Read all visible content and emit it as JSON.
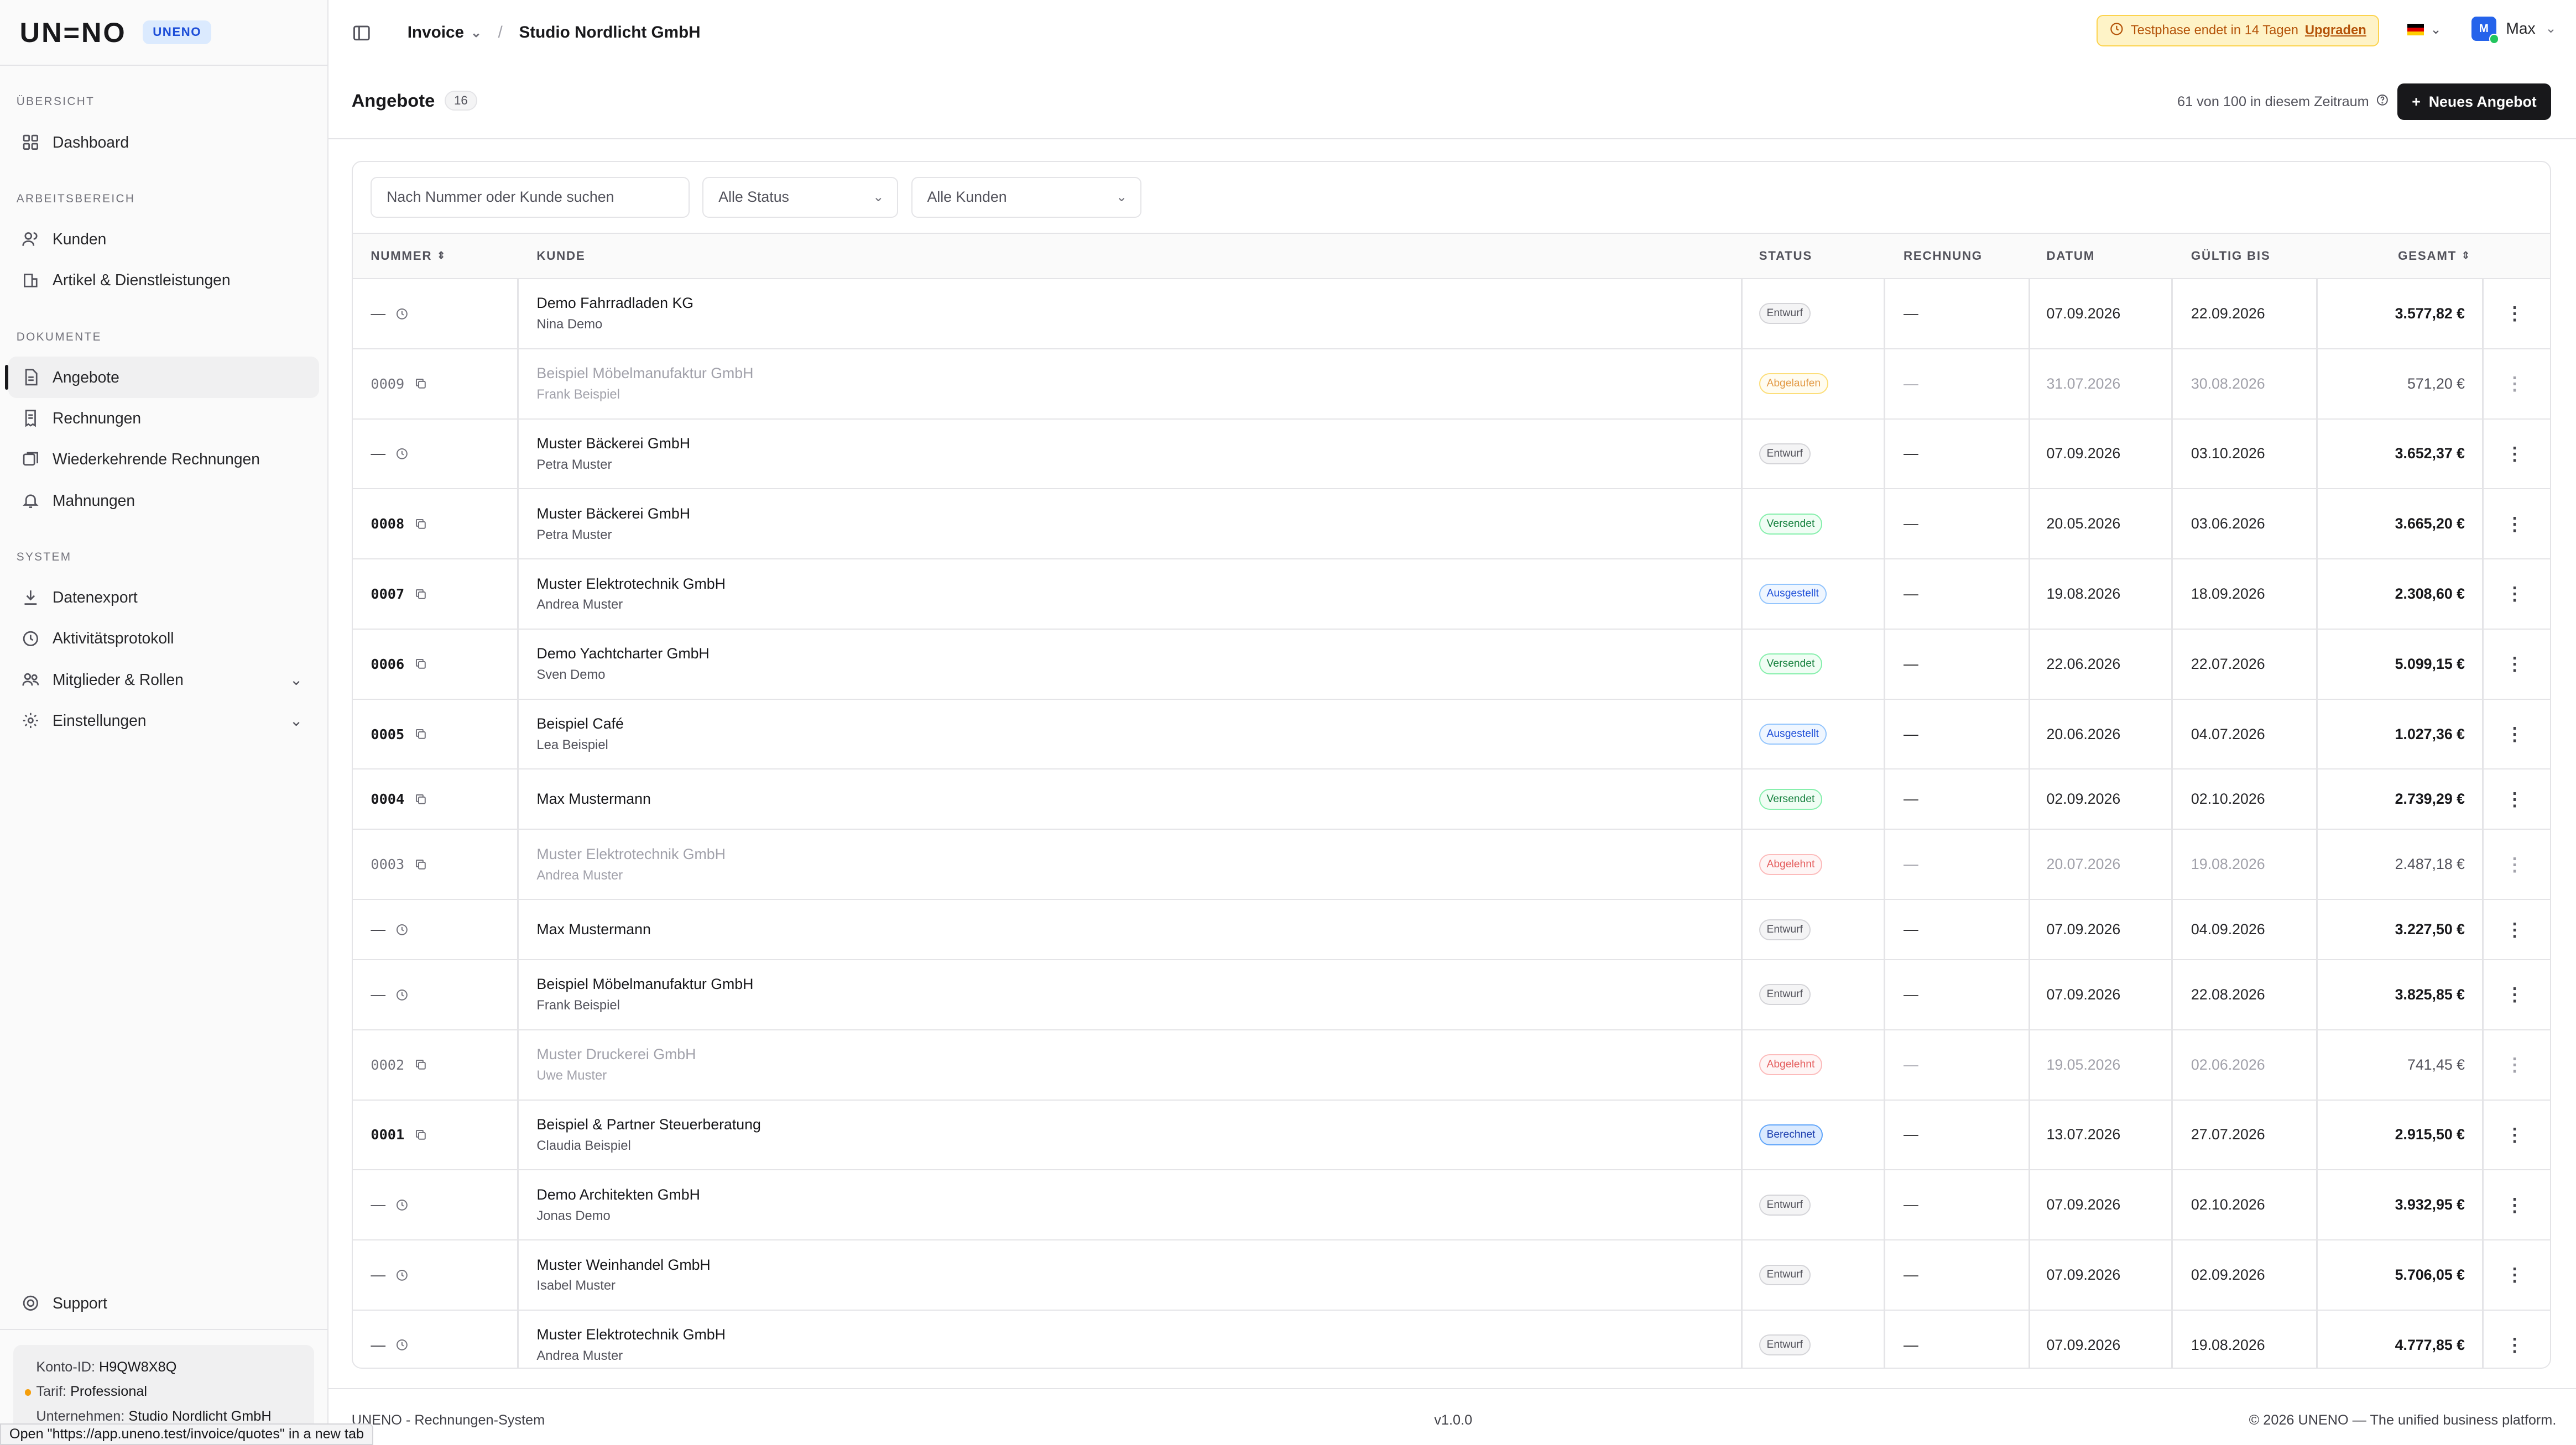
{
  "app": {
    "logo": "UN=NO",
    "badge": "UNENO"
  },
  "sidebar": {
    "sections": [
      {
        "title": "ÜBERSICHT",
        "items": [
          {
            "label": "Dashboard",
            "icon": "dashboard-icon"
          }
        ]
      },
      {
        "title": "ARBEITSBEREICH",
        "items": [
          {
            "label": "Kunden",
            "icon": "users-icon"
          },
          {
            "label": "Artikel & Dienstleistungen",
            "icon": "package-icon"
          }
        ]
      },
      {
        "title": "DOKUMENTE",
        "items": [
          {
            "label": "Angebote",
            "icon": "file-icon",
            "active": true
          },
          {
            "label": "Rechnungen",
            "icon": "receipt-icon"
          },
          {
            "label": "Wiederkehrende Rechnungen",
            "icon": "repeat-icon"
          },
          {
            "label": "Mahnungen",
            "icon": "bell-icon"
          }
        ]
      },
      {
        "title": "SYSTEM",
        "items": [
          {
            "label": "Datenexport",
            "icon": "download-icon"
          },
          {
            "label": "Aktivitätsprotokoll",
            "icon": "history-icon"
          },
          {
            "label": "Mitglieder & Rollen",
            "icon": "members-icon",
            "chevron": true
          },
          {
            "label": "Einstellungen",
            "icon": "gear-icon",
            "chevron": true
          }
        ]
      }
    ],
    "support": "Support",
    "account": {
      "konto_label": "Konto-ID:",
      "konto_value": "H9QW8X8Q",
      "tarif_label": "Tarif:",
      "tarif_value": "Professional",
      "firma_label": "Unternehmen:",
      "firma_value": "Studio Nordlicht GmbH"
    },
    "status_url": "Open \"https://app.uneno.test/invoice/quotes\" in a new tab"
  },
  "topbar": {
    "module": "Invoice",
    "separator": "/",
    "company": "Studio Nordlicht GmbH",
    "trial_text": "Testphase endet in 14 Tagen",
    "trial_link": "Upgraden",
    "user_initial": "M",
    "user_name": "Max"
  },
  "page": {
    "title": "Angebote",
    "count": "16",
    "quota": "61 von 100 in diesem Zeitraum",
    "new_button": "Neues Angebot"
  },
  "filters": {
    "search_placeholder": "Nach Nummer oder Kunde suchen",
    "status": "Alle Status",
    "customers": "Alle Kunden"
  },
  "table": {
    "headers": {
      "nummer": "NUMMER",
      "kunde": "KUNDE",
      "status": "STATUS",
      "rechnung": "RECHNUNG",
      "datum": "DATUM",
      "gueltig": "GÜLTIG BIS",
      "gesamt": "GESAMT"
    },
    "rows": [
      {
        "number": "—",
        "draft": true,
        "customer": "Demo Fahrradladen KG",
        "contact": "Nina Demo",
        "status": "Entwurf",
        "invoice": "—",
        "date": "07.09.2026",
        "valid": "22.09.2026",
        "total": "3.577,82 €"
      },
      {
        "number": "0009",
        "muted": true,
        "customer": "Beispiel Möbelmanufaktur GmbH",
        "contact": "Frank Beispiel",
        "status": "Abgelaufen",
        "invoice": "—",
        "date": "31.07.2026",
        "valid": "30.08.2026",
        "total": "571,20 €"
      },
      {
        "number": "—",
        "draft": true,
        "customer": "Muster Bäckerei GmbH",
        "contact": "Petra Muster",
        "status": "Entwurf",
        "invoice": "—",
        "date": "07.09.2026",
        "valid": "03.10.2026",
        "total": "3.652,37 €"
      },
      {
        "number": "0008",
        "customer": "Muster Bäckerei GmbH",
        "contact": "Petra Muster",
        "status": "Versendet",
        "invoice": "—",
        "date": "20.05.2026",
        "valid": "03.06.2026",
        "total": "3.665,20 €"
      },
      {
        "number": "0007",
        "customer": "Muster Elektrotechnik GmbH",
        "contact": "Andrea Muster",
        "status": "Ausgestellt",
        "invoice": "—",
        "date": "19.08.2026",
        "valid": "18.09.2026",
        "total": "2.308,60 €"
      },
      {
        "number": "0006",
        "customer": "Demo Yachtcharter GmbH",
        "contact": "Sven Demo",
        "status": "Versendet",
        "invoice": "—",
        "date": "22.06.2026",
        "valid": "22.07.2026",
        "total": "5.099,15 €"
      },
      {
        "number": "0005",
        "customer": "Beispiel Café",
        "contact": "Lea Beispiel",
        "status": "Ausgestellt",
        "invoice": "—",
        "date": "20.06.2026",
        "valid": "04.07.2026",
        "total": "1.027,36 €"
      },
      {
        "number": "0004",
        "customer": "Max Mustermann",
        "contact": "",
        "status": "Versendet",
        "invoice": "—",
        "date": "02.09.2026",
        "valid": "02.10.2026",
        "total": "2.739,29 €"
      },
      {
        "number": "0003",
        "muted": true,
        "customer": "Muster Elektrotechnik GmbH",
        "contact": "Andrea Muster",
        "status": "Abgelehnt",
        "invoice": "—",
        "date": "20.07.2026",
        "valid": "19.08.2026",
        "total": "2.487,18 €"
      },
      {
        "number": "—",
        "draft": true,
        "customer": "Max Mustermann",
        "contact": "",
        "status": "Entwurf",
        "invoice": "—",
        "date": "07.09.2026",
        "valid": "04.09.2026",
        "total": "3.227,50 €"
      },
      {
        "number": "—",
        "draft": true,
        "customer": "Beispiel Möbelmanufaktur GmbH",
        "contact": "Frank Beispiel",
        "status": "Entwurf",
        "invoice": "—",
        "date": "07.09.2026",
        "valid": "22.08.2026",
        "total": "3.825,85 €"
      },
      {
        "number": "0002",
        "muted": true,
        "customer": "Muster Druckerei GmbH",
        "contact": "Uwe Muster",
        "status": "Abgelehnt",
        "invoice": "—",
        "date": "19.05.2026",
        "valid": "02.06.2026",
        "total": "741,45 €"
      },
      {
        "number": "0001",
        "customer": "Beispiel & Partner Steuerberatung",
        "contact": "Claudia Beispiel",
        "status": "Berechnet",
        "invoice": "—",
        "date": "13.07.2026",
        "valid": "27.07.2026",
        "total": "2.915,50 €"
      },
      {
        "number": "—",
        "draft": true,
        "customer": "Demo Architekten GmbH",
        "contact": "Jonas Demo",
        "status": "Entwurf",
        "invoice": "—",
        "date": "07.09.2026",
        "valid": "02.10.2026",
        "total": "3.932,95 €"
      },
      {
        "number": "—",
        "draft": true,
        "customer": "Muster Weinhandel GmbH",
        "contact": "Isabel Muster",
        "status": "Entwurf",
        "invoice": "—",
        "date": "07.09.2026",
        "valid": "02.09.2026",
        "total": "5.706,05 €"
      },
      {
        "number": "—",
        "draft": true,
        "customer": "Muster Elektrotechnik GmbH",
        "contact": "Andrea Muster",
        "status": "Entwurf",
        "invoice": "—",
        "date": "07.09.2026",
        "valid": "19.08.2026",
        "total": "4.777,85 €"
      }
    ]
  },
  "footer": {
    "left": "UNENO - Rechnungen-System",
    "center": "v1.0.0",
    "right": "© 2026 UNENO — The unified business platform."
  }
}
